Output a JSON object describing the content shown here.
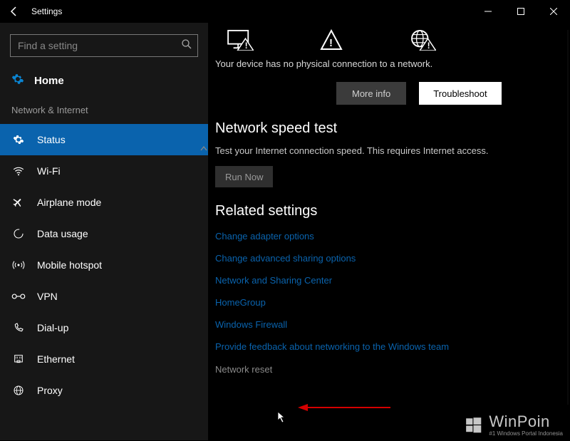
{
  "window": {
    "title": "Settings",
    "controls": {
      "minimize": "−",
      "maximize": "☐",
      "close": "✕"
    }
  },
  "sidebar": {
    "search_placeholder": "Find a setting",
    "home_label": "Home",
    "category": "Network & Internet",
    "items": [
      {
        "label": "Status",
        "icon": "gear",
        "active": true
      },
      {
        "label": "Wi-Fi",
        "icon": "wifi",
        "active": false
      },
      {
        "label": "Airplane mode",
        "icon": "airplane",
        "active": false
      },
      {
        "label": "Data usage",
        "icon": "data",
        "active": false
      },
      {
        "label": "Mobile hotspot",
        "icon": "hotspot",
        "active": false
      },
      {
        "label": "VPN",
        "icon": "vpn",
        "active": false
      },
      {
        "label": "Dial-up",
        "icon": "dialup",
        "active": false
      },
      {
        "label": "Ethernet",
        "icon": "ethernet",
        "active": false
      },
      {
        "label": "Proxy",
        "icon": "proxy",
        "active": false
      }
    ]
  },
  "main": {
    "connection_msg": "Your device has no physical connection to a network.",
    "buttons": {
      "more_info": "More info",
      "troubleshoot": "Troubleshoot"
    },
    "speed_test": {
      "heading": "Network speed test",
      "description": "Test your Internet connection speed. This requires Internet access.",
      "run_label": "Run Now"
    },
    "related": {
      "heading": "Related settings",
      "links": [
        "Change adapter options",
        "Change advanced sharing options",
        "Network and Sharing Center",
        "HomeGroup",
        "Windows Firewall",
        "Provide feedback about networking to the Windows team"
      ],
      "reset": "Network reset"
    }
  },
  "watermark": {
    "main": "WinPoin",
    "sub": "#1 Windows Portal Indonesia"
  }
}
